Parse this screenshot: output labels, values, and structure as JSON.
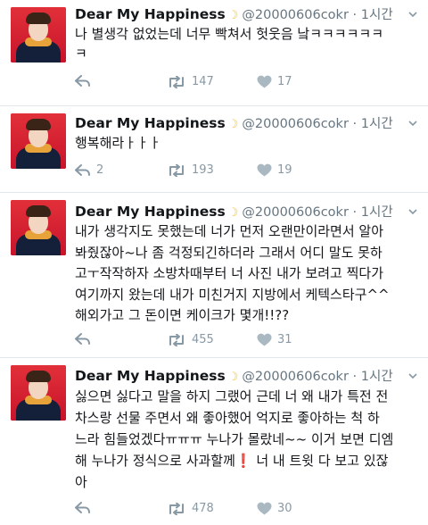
{
  "tweets": [
    {
      "name": "Dear My Happiness",
      "handle": "@20000606cokr",
      "time": "1시간",
      "text": "나 별생각 없었는데 너무 빡쳐서 헛웃음 낰ㅋㅋㅋㅋㅋㅋ\nㅋ",
      "replies": "",
      "retweets": "147",
      "likes": "17"
    },
    {
      "name": "Dear My Happiness",
      "handle": "@20000606cokr",
      "time": "1시간",
      "text": "행복해라ㅏㅏㅏ",
      "replies": "2",
      "retweets": "193",
      "likes": "19"
    },
    {
      "name": "Dear My Happiness",
      "handle": "@20000606cokr",
      "time": "1시간",
      "text": "내가 생각지도 못했는데 너가 먼저 오랜만이라면서 알아\n봐줬잖아~나 좀 걱정되긴하더라 그래서 어디 말도 못하\n고ㅜ작작하자 소방차때부터 너 사진 내가 보려고 찍다가\n여기까지 왔는데 내가 미친거지 지방에서 케텍스타구^^\n해외가고 그 돈이면 케이크가 몇개!!??",
      "replies": "",
      "retweets": "455",
      "likes": "31"
    },
    {
      "name": "Dear My Happiness",
      "handle": "@20000606cokr",
      "time": "1시간",
      "text": "싫으면 싫다고 말을 하지 그랬어 근데 너 왜 내가 특전 전\n차스랑 선물 주면서 왜 좋아했어 억지로 좋아하는 척 하\n느라 힘들었겠다ㅠㅠㅠ 누나가 몰랐네~~ 이거 보면 디엠\n해 누나가 정식으로 사과할께❗ 너 내 트윗 다 보고 있잖\n아",
      "replies": "",
      "retweets": "478",
      "likes": "30"
    }
  ]
}
